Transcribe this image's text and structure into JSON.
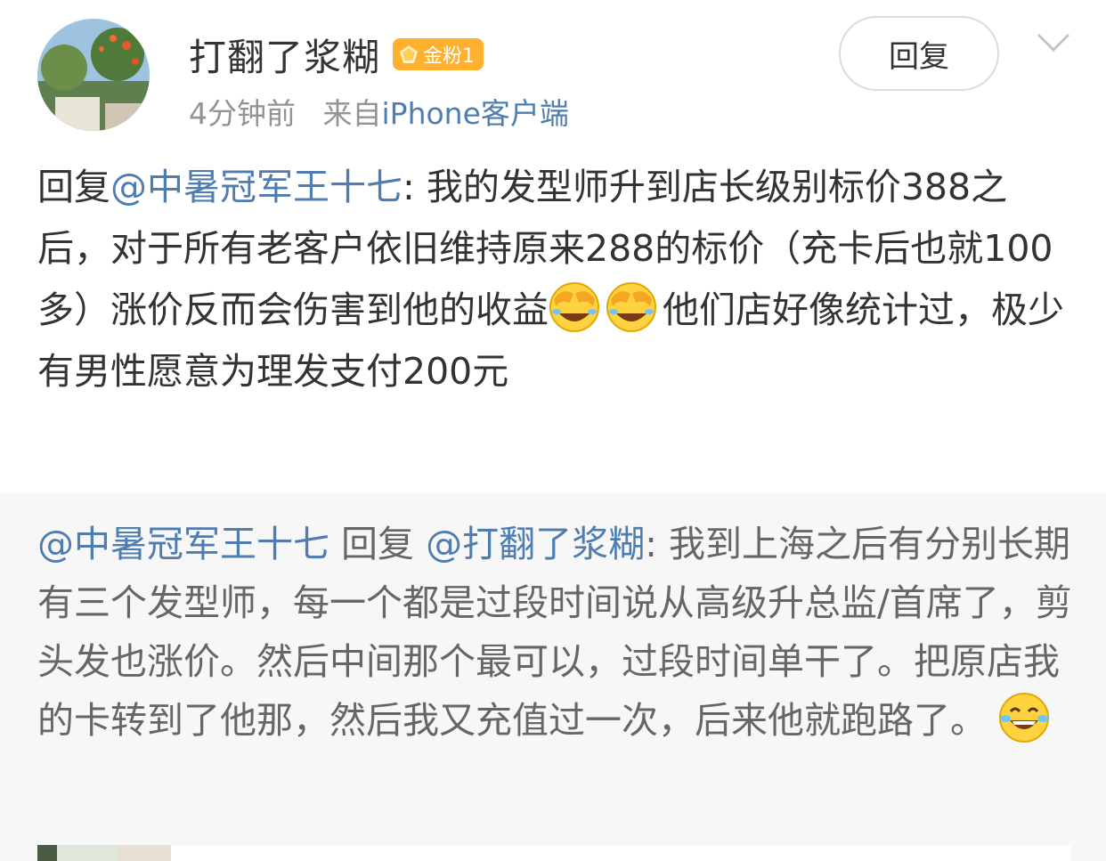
{
  "user": {
    "name": "打翻了浆糊",
    "badge": "金粉1",
    "time": "4分钟前",
    "source_prefix": "来自",
    "source": "iPhone客户端"
  },
  "actions": {
    "reply_label": "回复",
    "more_icon": "chevron-down-icon"
  },
  "comment": {
    "prefix": "回复",
    "mention": "@中暑冠军王十七",
    "text1": ": 我的发型师升到店长级别标价388之后，对于所有老客户依旧维持原来288的标价（充卡后也就100多）涨价反而会伤害到他的收益",
    "text2": "他们店好像统计过，极少有男性愿意为理发支付200元",
    "emoji": "face-palm-laughing"
  },
  "quote": {
    "from": "@中暑冠军王十七",
    "verb": "回复",
    "to": "@打翻了浆糊",
    "text": ": 我到上海之后有分别长期有三个发型师，每一个都是过段时间说从高级升总监/首席了，剪头发也涨价。然后中间那个最可以，过段时间单干了。把原店我的卡转到了他那，然后我又充值过一次，后来他就跑路了。",
    "emoji": "tears-of-joy"
  },
  "colors": {
    "link": "#507daf",
    "badge": "#ffb02e",
    "quote_bg": "#f7f7f7",
    "meta": "#939393"
  }
}
